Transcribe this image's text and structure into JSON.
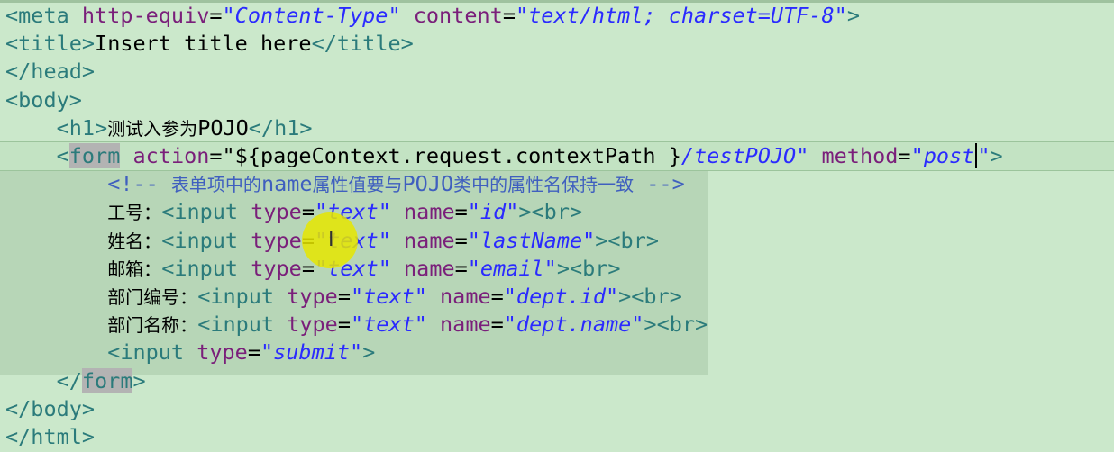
{
  "lines": [
    {
      "parts": [
        [
          "tag",
          "<meta "
        ],
        [
          "attr",
          "http-equiv"
        ],
        [
          "txt",
          "="
        ],
        [
          "val",
          "\"Content-Type\""
        ],
        [
          "txt",
          " "
        ],
        [
          "attr",
          "content"
        ],
        [
          "txt",
          "="
        ],
        [
          "val",
          "\"text/html; charset=UTF-8\""
        ],
        [
          "tag",
          ">"
        ]
      ]
    },
    {
      "parts": [
        [
          "tag",
          "<title>"
        ],
        [
          "txt",
          "Insert title here"
        ],
        [
          "tag",
          "</title>"
        ]
      ]
    },
    {
      "parts": [
        [
          "tag",
          "</head>"
        ]
      ]
    },
    {
      "parts": [
        [
          "tag",
          "<body>"
        ]
      ]
    },
    {
      "parts": [
        [
          "txt",
          "    "
        ],
        [
          "tag",
          "<h1>"
        ],
        [
          "cjk",
          "测试入参为"
        ],
        [
          "txt",
          "POJO"
        ],
        [
          "tag",
          "</h1>"
        ]
      ]
    },
    {
      "parts": [
        [
          "txt",
          "    "
        ],
        [
          "tag",
          "<"
        ],
        [
          "hltag",
          "form"
        ],
        [
          "txt",
          " "
        ],
        [
          "attr",
          "action"
        ],
        [
          "txt",
          "=\"${pageContext.request.contextPath }"
        ],
        [
          "val",
          "/testPOJO\""
        ],
        [
          "txt",
          " "
        ],
        [
          "attr",
          "method"
        ],
        [
          "txt",
          "="
        ],
        [
          "val",
          "\"post"
        ],
        [
          "caret",
          ""
        ],
        [
          "val",
          "\""
        ],
        [
          "tag",
          ">"
        ]
      ]
    },
    {
      "parts": [
        [
          "txt",
          "        "
        ],
        [
          "cmt",
          "<!-- "
        ],
        [
          "cmtcjk",
          "表单项中的"
        ],
        [
          "cmt",
          "name"
        ],
        [
          "cmtcjk",
          "属性值要与"
        ],
        [
          "cmt",
          "POJO"
        ],
        [
          "cmtcjk",
          "类中的属性名保持一致"
        ],
        [
          "cmt",
          " -->"
        ]
      ]
    },
    {
      "parts": [
        [
          "txt",
          "        "
        ],
        [
          "cjk",
          "工号："
        ],
        [
          "tag",
          "<input "
        ],
        [
          "attr",
          "type"
        ],
        [
          "txt",
          "="
        ],
        [
          "val",
          "\"text\""
        ],
        [
          "txt",
          " "
        ],
        [
          "attr",
          "name"
        ],
        [
          "txt",
          "="
        ],
        [
          "val",
          "\"id\""
        ],
        [
          "tag",
          "><br>"
        ]
      ]
    },
    {
      "parts": [
        [
          "txt",
          "        "
        ],
        [
          "cjk",
          "姓名："
        ],
        [
          "tag",
          "<input "
        ],
        [
          "attr",
          "type"
        ],
        [
          "txt",
          "="
        ],
        [
          "val",
          "\"text\""
        ],
        [
          "txt",
          " "
        ],
        [
          "attr",
          "name"
        ],
        [
          "txt",
          "="
        ],
        [
          "val",
          "\"lastName\""
        ],
        [
          "tag",
          "><br>"
        ]
      ]
    },
    {
      "parts": [
        [
          "txt",
          "        "
        ],
        [
          "cjk",
          "邮箱："
        ],
        [
          "tag",
          "<input "
        ],
        [
          "attr",
          "type"
        ],
        [
          "txt",
          "="
        ],
        [
          "val",
          "\"text\""
        ],
        [
          "txt",
          " "
        ],
        [
          "attr",
          "name"
        ],
        [
          "txt",
          "="
        ],
        [
          "val",
          "\"email\""
        ],
        [
          "tag",
          "><br>"
        ]
      ]
    },
    {
      "parts": [
        [
          "txt",
          "        "
        ],
        [
          "cjk",
          "部门编号："
        ],
        [
          "tag",
          "<input "
        ],
        [
          "attr",
          "type"
        ],
        [
          "txt",
          "="
        ],
        [
          "val",
          "\"text\""
        ],
        [
          "txt",
          " "
        ],
        [
          "attr",
          "name"
        ],
        [
          "txt",
          "="
        ],
        [
          "val",
          "\"dept.id\""
        ],
        [
          "tag",
          "><br>"
        ]
      ]
    },
    {
      "parts": [
        [
          "txt",
          "        "
        ],
        [
          "cjk",
          "部门名称："
        ],
        [
          "tag",
          "<input "
        ],
        [
          "attr",
          "type"
        ],
        [
          "txt",
          "="
        ],
        [
          "val",
          "\"text\""
        ],
        [
          "txt",
          " "
        ],
        [
          "attr",
          "name"
        ],
        [
          "txt",
          "="
        ],
        [
          "val",
          "\"dept.name\""
        ],
        [
          "tag",
          "><br>"
        ]
      ]
    },
    {
      "parts": [
        [
          "txt",
          "        "
        ],
        [
          "tag",
          "<input "
        ],
        [
          "attr",
          "type"
        ],
        [
          "txt",
          "="
        ],
        [
          "val",
          "\"submit\""
        ],
        [
          "tag",
          ">"
        ]
      ]
    },
    {
      "parts": [
        [
          "txt",
          "    "
        ],
        [
          "tag",
          "</"
        ],
        [
          "hltag",
          "form"
        ],
        [
          "tag",
          ">"
        ]
      ]
    },
    {
      "parts": [
        [
          "tag",
          "</body>"
        ]
      ]
    },
    {
      "parts": [
        [
          "tag",
          "</html>"
        ]
      ]
    }
  ],
  "cursor_icon": "i-beam-icon"
}
